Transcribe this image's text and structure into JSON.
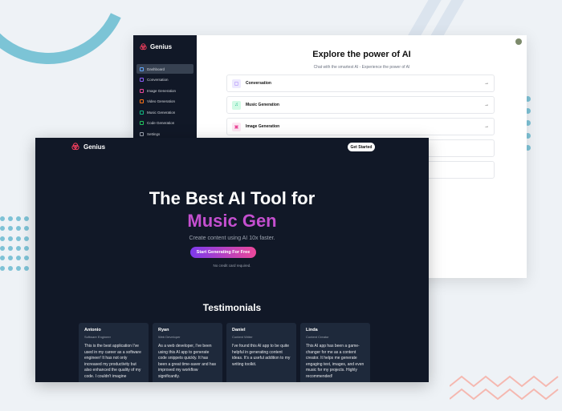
{
  "dashboard": {
    "logo_text": "Genius",
    "title": "Explore the power of AI",
    "subtitle": "Chat with the smartest AI - Experience the power of AI",
    "sidebar": [
      {
        "label": "Dashboard",
        "color": "#60a5fa",
        "active": true
      },
      {
        "label": "Conversation",
        "color": "#8b5cf6"
      },
      {
        "label": "Image Generation",
        "color": "#ec4899"
      },
      {
        "label": "Video Generation",
        "color": "#f97316"
      },
      {
        "label": "Music Generation",
        "color": "#10b981"
      },
      {
        "label": "Code Generation",
        "color": "#22c55e"
      },
      {
        "label": "Settings",
        "color": "#9ca3af"
      }
    ],
    "tools": [
      {
        "label": "Conversation",
        "icon": "chat-icon",
        "color": "#8b5cf6",
        "bg": "#ede9fe"
      },
      {
        "label": "Music Generation",
        "icon": "music-icon",
        "color": "#10b981",
        "bg": "#d1fae5"
      },
      {
        "label": "Image Generation",
        "icon": "image-icon",
        "color": "#ec4899",
        "bg": "#fce7f3"
      },
      {
        "label": "",
        "icon": "",
        "color": "#fff",
        "bg": "#fff"
      },
      {
        "label": "",
        "icon": "",
        "color": "#fff",
        "bg": "#fff"
      }
    ]
  },
  "landing": {
    "logo_text": "Genius",
    "cta_top": "Get Started",
    "headline": "The Best AI Tool for",
    "headline_accent": "Music Gen",
    "description": "Create content using AI 10x faster.",
    "cta_main": "Start Generating For Free",
    "note": "No credit card required.",
    "testimonials_title": "Testimonials",
    "testimonials": [
      {
        "name": "Antonio",
        "role": "Software Engineer",
        "text": "This is the best application I've used in my career as a software engineer! It has not only increased my productivity but also enhanced the quality of my code. I couldn't imagine"
      },
      {
        "name": "Ryan",
        "role": "Web Developer",
        "text": "As a web developer, I've been using this AI app to generate code snippets quickly. It has been a great time-saver and has improved my workflow significantly."
      },
      {
        "name": "Daniel",
        "role": "Content Writer",
        "text": "I've found this AI app to be quite helpful in generating content ideas. It's a useful addition to my writing toolkit."
      },
      {
        "name": "Linda",
        "role": "Content Creator",
        "text": "This AI app has been a game-changer for me as a content creator. It helps me generate engaging text, images, and even music for my projects. Highly recommended!"
      }
    ]
  }
}
